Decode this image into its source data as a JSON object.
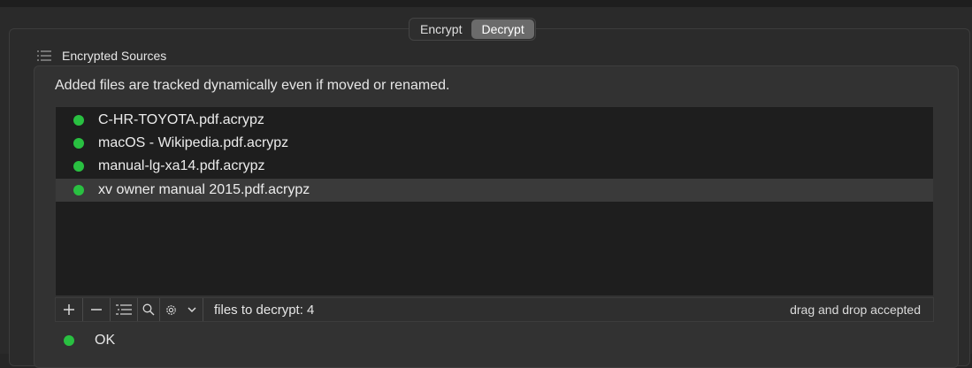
{
  "tabs": [
    {
      "label": "Encrypt",
      "active": false
    },
    {
      "label": "Decrypt",
      "active": true
    }
  ],
  "section": {
    "title": "Encrypted Sources",
    "icon": "list-icon"
  },
  "description": "Added files are tracked dynamically  even if moved or renamed.",
  "files": [
    {
      "name": "C-HR-TOYOTA.pdf.acrypz",
      "status_color": "#29c041",
      "selected": false
    },
    {
      "name": "macOS - Wikipedia.pdf.acrypz",
      "status_color": "#29c041",
      "selected": false
    },
    {
      "name": "manual-lg-xa14.pdf.acrypz",
      "status_color": "#29c041",
      "selected": false
    },
    {
      "name": "xv owner manual 2015.pdf.acrypz",
      "status_color": "#29c041",
      "selected": true
    }
  ],
  "toolbar": {
    "add_icon": "plus-icon",
    "remove_icon": "minus-icon",
    "list_icon": "list-icon",
    "search_icon": "search-icon",
    "settings_icon": "gear-icon",
    "dropdown_icon": "chevron-down-icon",
    "files_count": "files to decrypt: 4",
    "drag_drop_hint": "drag and drop accepted"
  },
  "status": {
    "text": "OK",
    "color": "#29c041"
  }
}
